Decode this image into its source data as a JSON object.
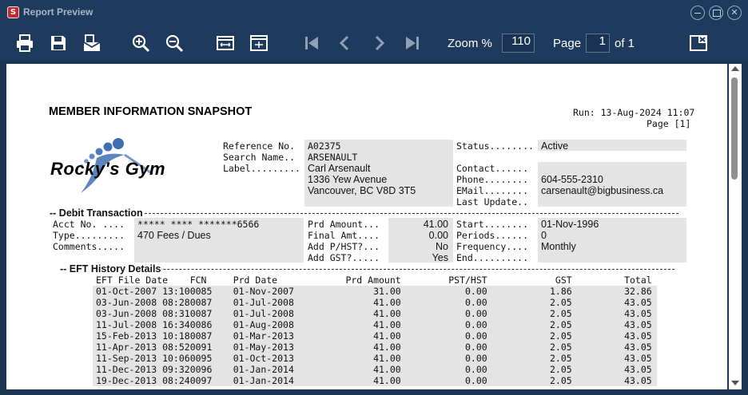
{
  "window": {
    "title": "Report Preview",
    "app_icon_letter": "S"
  },
  "toolbar": {
    "zoom_label": "Zoom %",
    "zoom_value": "110",
    "page_label": "Page",
    "page_value": "1",
    "of_label": "of 1"
  },
  "report": {
    "title": "MEMBER INFORMATION SNAPSHOT",
    "run": "Run:  13-Aug-2024 11:07",
    "page": "Page [1]",
    "logo_text": "Rocky's Gym",
    "member": {
      "ref_label": "Reference No.",
      "ref_value": "A02375",
      "search_label": "Search Name..",
      "search_value": "ARSENAULT",
      "label_label": "Label.........",
      "label_lines": [
        "Carl Arsenault",
        "1336 Yew Avenue",
        "Vancouver, BC V8D 3T5"
      ],
      "status_label": "Status........",
      "status_value": "Active",
      "contact_label": "Contact......",
      "phone_label": "Phone........",
      "phone_value": "604-555-2310",
      "email_label": "EMail........",
      "email_value": "carsenault@bigbusiness.ca",
      "lastupdate_label": "Last Update.."
    },
    "debit": {
      "section_label": "-- Debit Transaction",
      "acct_label": "Acct No. ....",
      "acct_value": "***** **** *******6566",
      "type_label": "Type.........",
      "type_value": "470  Fees / Dues",
      "comments_label": "Comments.....",
      "prd_amount_label": "Prd Amount...",
      "prd_amount_value": "41.00",
      "final_amt_label": "Final Amt....",
      "final_amt_value": "0.00",
      "add_phst_label": "Add P/HST?...",
      "add_phst_value": "No",
      "add_gst_label": "Add GST?.....",
      "add_gst_value": "Yes",
      "start_label": "Start........",
      "start_value": "01-Nov-1996",
      "periods_label": "Periods......",
      "periods_value": "0",
      "frequency_label": "Frequency....",
      "frequency_value": "Monthly",
      "end_label": "End.........."
    },
    "history": {
      "section_label": "-- EFT History Details",
      "headers": [
        "EFT File Date",
        "FCN",
        "Prd Date",
        "Prd Amount",
        "PST/HST",
        "GST",
        "Total"
      ],
      "rows": [
        [
          "01-Oct-2007 13:10",
          "0085",
          "01-Nov-2007",
          "31.00",
          "0.00",
          "1.86",
          "32.86"
        ],
        [
          "03-Jun-2008 08:28",
          "0087",
          "01-Jul-2008",
          "41.00",
          "0.00",
          "2.05",
          "43.05"
        ],
        [
          "03-Jun-2008 08:31",
          "0087",
          "01-Jul-2008",
          "41.00",
          "0.00",
          "2.05",
          "43.05"
        ],
        [
          "11-Jul-2008 16:34",
          "0086",
          "01-Aug-2008",
          "41.00",
          "0.00",
          "2.05",
          "43.05"
        ],
        [
          "15-Feb-2013 10:18",
          "0087",
          "01-Mar-2013",
          "41.00",
          "0.00",
          "2.05",
          "43.05"
        ],
        [
          "11-Apr-2013 08:52",
          "0091",
          "01-May-2013",
          "41.00",
          "0.00",
          "2.05",
          "43.05"
        ],
        [
          "11-Sep-2013 10:06",
          "0095",
          "01-Oct-2013",
          "41.00",
          "0.00",
          "2.05",
          "43.05"
        ],
        [
          "11-Dec-2013 09:32",
          "0096",
          "01-Jan-2014",
          "41.00",
          "0.00",
          "2.05",
          "43.05"
        ],
        [
          "19-Dec-2013 08:24",
          "0097",
          "01-Jan-2014",
          "41.00",
          "0.00",
          "2.05",
          "43.05"
        ]
      ]
    }
  }
}
